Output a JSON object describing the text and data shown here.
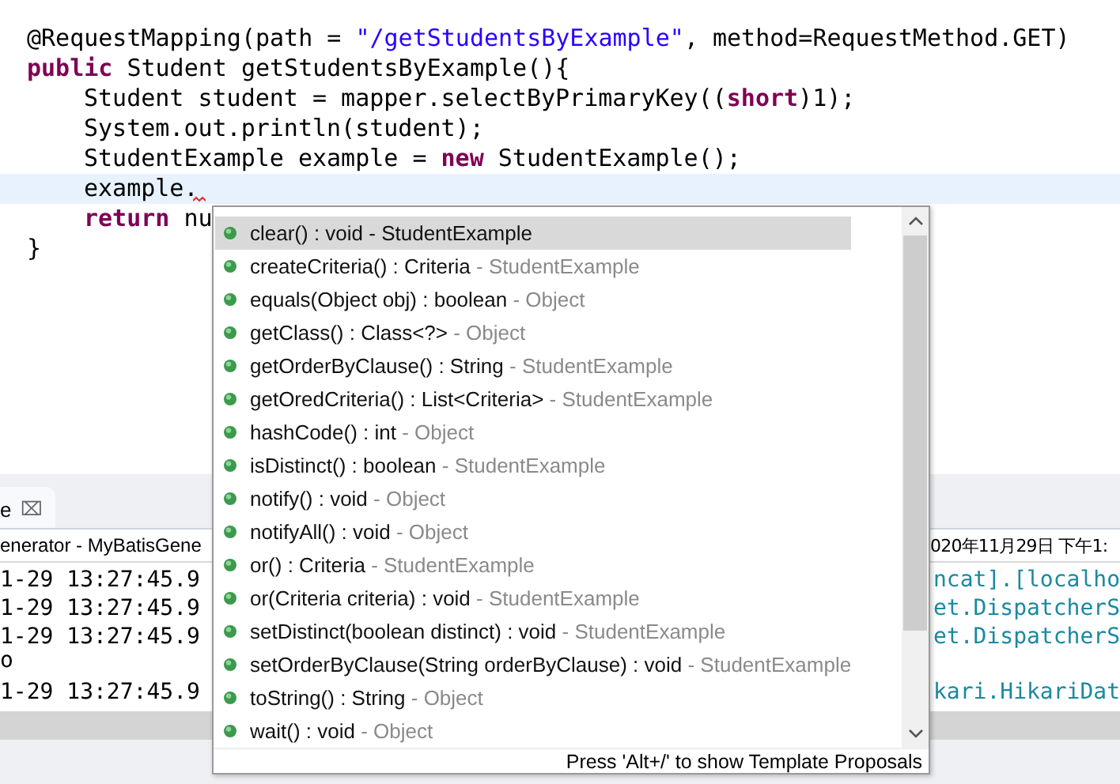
{
  "editor": {
    "lines": [
      {
        "current": false,
        "segments": [
          {
            "kind": "plain",
            "text": "@RequestMapping(path = "
          },
          {
            "kind": "string",
            "text": "\"/getStudentsByExample\""
          },
          {
            "kind": "plain",
            "text": ", method=RequestMethod.GET)"
          }
        ]
      },
      {
        "current": false,
        "segments": [
          {
            "kind": "keyword",
            "text": "public"
          },
          {
            "kind": "plain",
            "text": " Student getStudentsByExample(){"
          }
        ],
        "children": [
          {
            "current": false,
            "segments": [
              {
                "kind": "plain",
                "text": "Student student = mapper.selectByPrimaryKey(("
              },
              {
                "kind": "keyword",
                "text": "short"
              },
              {
                "kind": "plain",
                "text": ")1);"
              }
            ]
          },
          {
            "current": false,
            "segments": [
              {
                "kind": "plain",
                "text": "System.out.println(student);"
              }
            ]
          },
          {
            "current": false,
            "segments": [
              {
                "kind": "plain",
                "text": "StudentExample example = "
              },
              {
                "kind": "keyword",
                "text": "new"
              },
              {
                "kind": "plain",
                "text": " StudentExample();"
              }
            ]
          },
          {
            "current": true,
            "squiggle": true,
            "segments": [
              {
                "kind": "plain",
                "text": "example."
              }
            ]
          },
          {
            "current": false,
            "segments": [
              {
                "kind": "keyword",
                "text": "return"
              },
              {
                "kind": "plain",
                "text": " nu"
              }
            ]
          }
        ]
      },
      {
        "current": false,
        "segments": [
          {
            "kind": "plain",
            "text": "}"
          }
        ]
      }
    ]
  },
  "console": {
    "tab": {
      "label": "e",
      "close": "⌧"
    },
    "header_left": "enerator - MyBatisGene",
    "header_right": "020年11月29日 下午1:",
    "rows": [
      {
        "left": "1-29 13:27:45.9",
        "right": "ncat].[localho"
      },
      {
        "left": "1-29 13:27:45.9",
        "right": "et.DispatcherS"
      },
      {
        "left": "1-29 13:27:45.9",
        "right": "et.DispatcherS"
      },
      {
        "left": "o",
        "right": ""
      },
      {
        "left": "1-29 13:27:45.9",
        "right": "kari.HikariDat"
      }
    ]
  },
  "completion": {
    "items": [
      {
        "signature": "clear() : void",
        "owner": "- StudentExample",
        "selected": true
      },
      {
        "signature": "createCriteria() : Criteria",
        "owner": "- StudentExample",
        "selected": false
      },
      {
        "signature": "equals(Object obj) : boolean",
        "owner": "- Object",
        "selected": false
      },
      {
        "signature": "getClass() : Class<?>",
        "owner": "- Object",
        "selected": false
      },
      {
        "signature": "getOrderByClause() : String",
        "owner": "- StudentExample",
        "selected": false
      },
      {
        "signature": "getOredCriteria() : List<Criteria>",
        "owner": "- StudentExample",
        "selected": false
      },
      {
        "signature": "hashCode() : int",
        "owner": "- Object",
        "selected": false
      },
      {
        "signature": "isDistinct() : boolean",
        "owner": "- StudentExample",
        "selected": false
      },
      {
        "signature": "notify() : void",
        "owner": "- Object",
        "selected": false
      },
      {
        "signature": "notifyAll() : void",
        "owner": "- Object",
        "selected": false
      },
      {
        "signature": "or() : Criteria",
        "owner": "- StudentExample",
        "selected": false
      },
      {
        "signature": "or(Criteria criteria) : void",
        "owner": "- StudentExample",
        "selected": false
      },
      {
        "signature": "setDistinct(boolean distinct) : void",
        "owner": "- StudentExample",
        "selected": false
      },
      {
        "signature": "setOrderByClause(String orderByClause) : void",
        "owner": "- StudentExample",
        "selected": false
      },
      {
        "signature": "toString() : String",
        "owner": "- Object",
        "selected": false
      },
      {
        "signature": "wait() : void",
        "owner": "- Object",
        "selected": false
      }
    ],
    "footer": "Press 'Alt+/' to show Template Proposals"
  }
}
